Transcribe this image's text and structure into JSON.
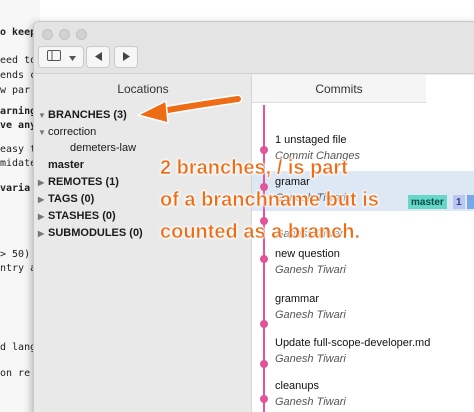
{
  "background_editor": {
    "lines": [
      {
        "text": "o keep",
        "bold": true
      },
      {
        "text": "eed to",
        "bold": false
      },
      {
        "text": "ends c",
        "bold": false
      },
      {
        "text": "w par",
        "bold": false
      },
      {
        "text": "arning",
        "bold": true
      },
      {
        "text": "ve any",
        "bold": true
      },
      {
        "text": "easy t",
        "bold": false
      },
      {
        "text": "midate",
        "bold": false
      },
      {
        "text": " varia",
        "bold": true
      },
      {
        "text": "> 50)",
        "bold": false
      },
      {
        "text": "ntry a",
        "bold": false
      },
      {
        "text": "d lang",
        "bold": false
      },
      {
        "text": " on re",
        "bold": false
      }
    ]
  },
  "toolbar": {
    "back_icon": "chevron-left-icon",
    "forward_icon": "chevron-right-icon",
    "sidebar_toggle_icon": "sidebar-icon"
  },
  "sidebar": {
    "header": "Locations",
    "branches_label": "BRANCHES (3)",
    "branches": [
      {
        "label": "correction",
        "level": 1,
        "expanded": true
      },
      {
        "label": "demeters-law",
        "level": 2
      },
      {
        "label": "master",
        "level": 0
      }
    ],
    "sections": [
      {
        "label": "REMOTES (1)"
      },
      {
        "label": "TAGS (0)"
      },
      {
        "label": "STASHES (0)"
      },
      {
        "label": "SUBMODULES (0)"
      }
    ]
  },
  "commits": {
    "header": "Commits",
    "items": [
      {
        "title": "1 unstaged file",
        "author": "Commit Changes"
      },
      {
        "title": "gramar",
        "author": "Ganesh Tiwari",
        "selected": true,
        "badge": "master",
        "badge_count": "1"
      },
      {
        "title": "",
        "author": "Ganesh Tiwari"
      },
      {
        "title": "new question",
        "author": "Ganesh Tiwari"
      },
      {
        "title": "grammar",
        "author": "Ganesh Tiwari"
      },
      {
        "title": "Update full-scope-developer.md",
        "author": "Ganesh Tiwari"
      },
      {
        "title": "cleanups",
        "author": "Ganesh Tiwari"
      }
    ]
  },
  "annotation": {
    "lines": [
      "2 branches, / is part",
      "of a branchname but is",
      "counted as a branch."
    ],
    "color": "#ee6c16"
  },
  "colors": {
    "graph": "#e0559b",
    "badge_bg": "#66d7c8",
    "badge_count_bg": "#b9c7f2"
  }
}
